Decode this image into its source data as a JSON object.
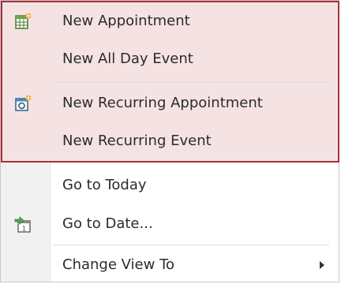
{
  "menu": {
    "items": [
      {
        "label": "New Appointment",
        "icon": "new-appointment-icon"
      },
      {
        "label": "New All Day Event"
      },
      {
        "label": "New Recurring Appointment",
        "icon": "recurring-appointment-icon"
      },
      {
        "label": "New Recurring Event"
      },
      {
        "label": "Go to Today"
      },
      {
        "label": "Go to Date...",
        "icon": "go-to-date-icon"
      },
      {
        "label": "Change View To",
        "submenu": true
      }
    ]
  },
  "colors": {
    "highlight_fill": "#f5e3e4",
    "highlight_border": "#a3333a",
    "gutter": "#f1f1f1",
    "separator": "#dcdcdc"
  }
}
